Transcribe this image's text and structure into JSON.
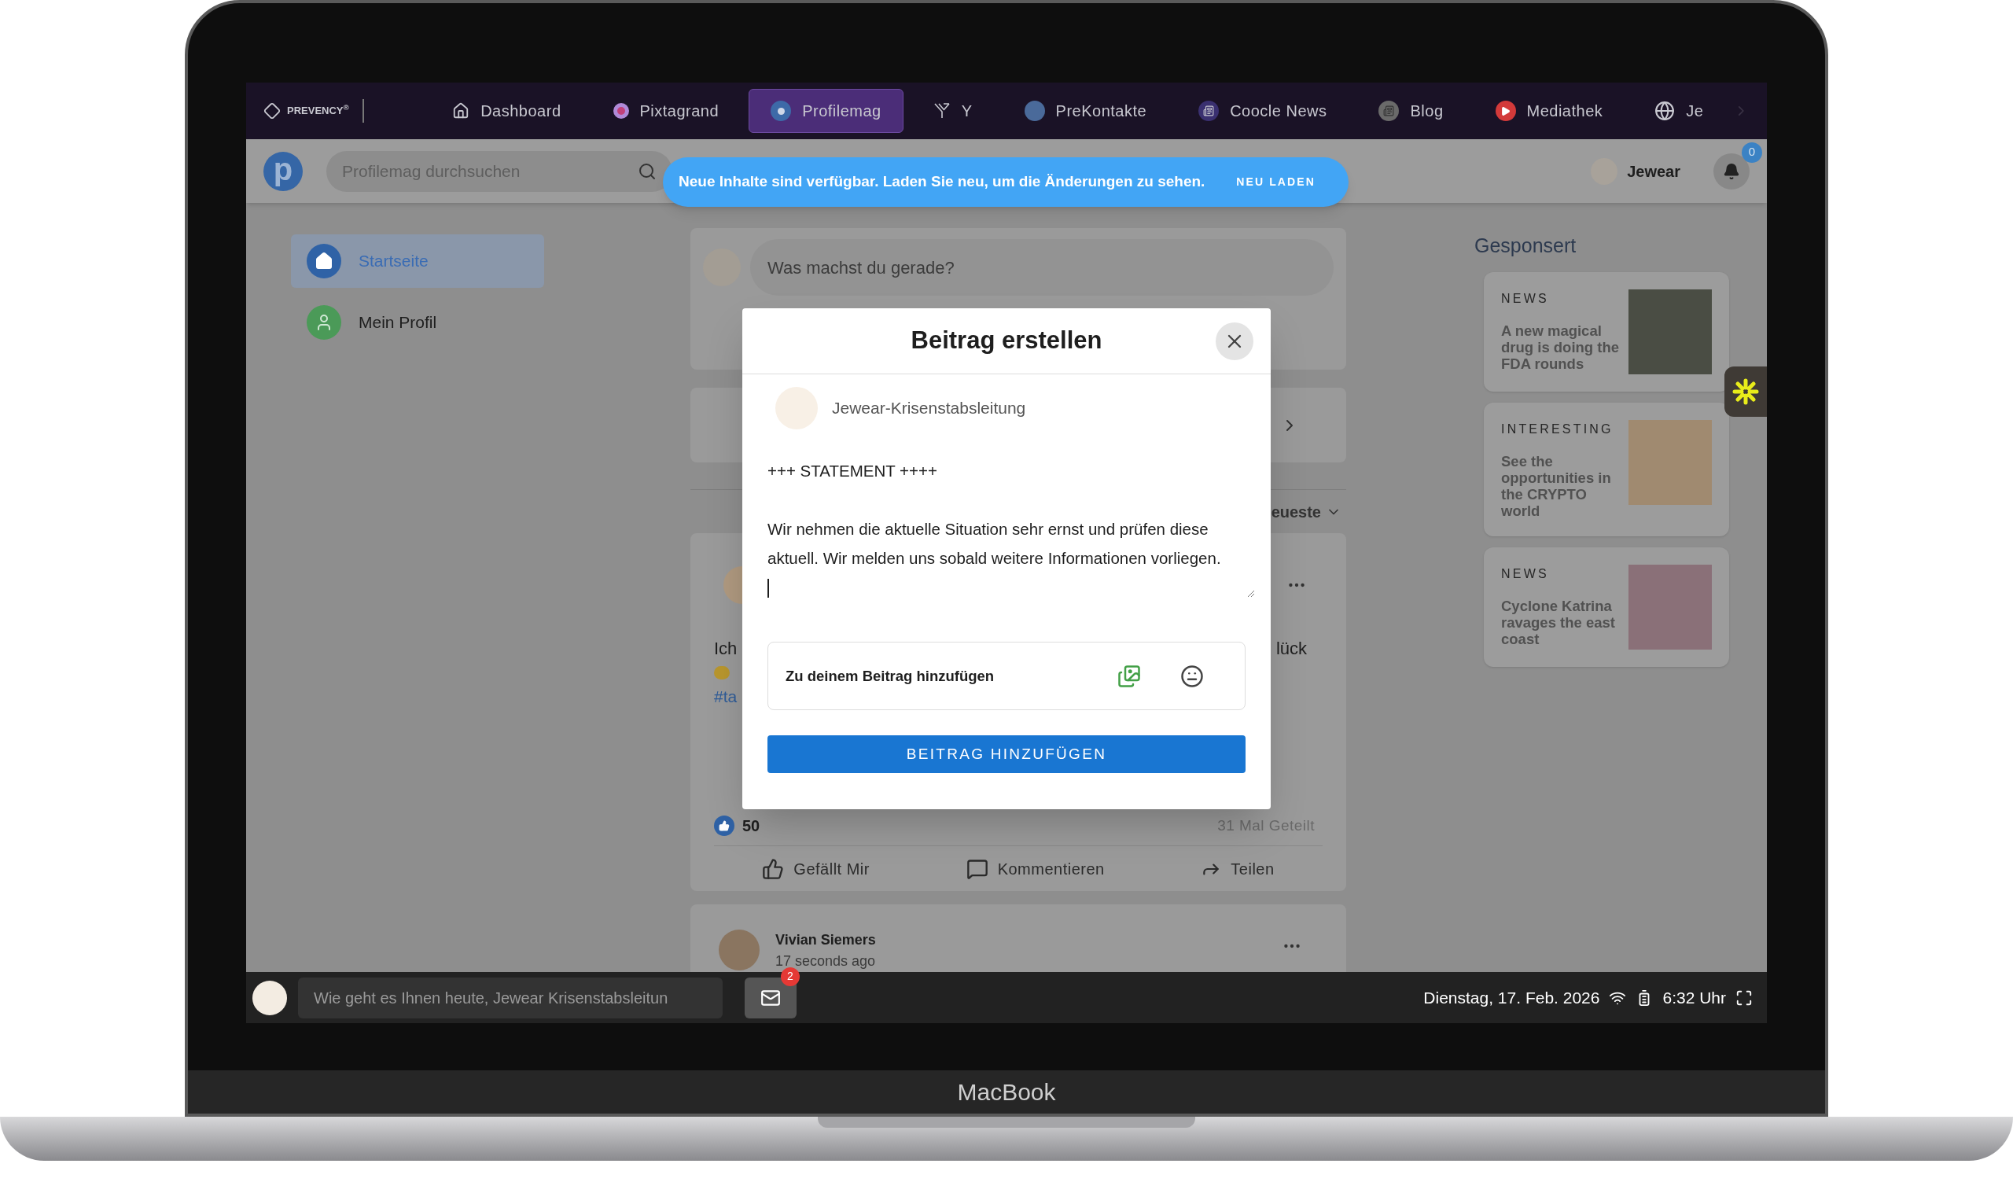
{
  "top_nav": {
    "logo": "PREVENCY$^{®}$",
    "items": [
      {
        "label": "Dashboard",
        "selected": false
      },
      {
        "label": "Pixtagrand",
        "selected": false
      },
      {
        "label": "Profilemag",
        "selected": true
      },
      {
        "label": "Y",
        "selected": false
      },
      {
        "label": "PreKontakte",
        "selected": false
      },
      {
        "label": "Coocle News",
        "selected": false
      },
      {
        "label": "Blog",
        "selected": false
      },
      {
        "label": "Mediathek",
        "selected": false
      },
      {
        "label": "Je",
        "selected": false
      }
    ]
  },
  "header": {
    "logo": "p",
    "search_placeholder": "Profilemag durchsuchen",
    "user": "Jewear",
    "notification_count": "0"
  },
  "toast": {
    "message": "Neue Inhalte sind verfügbar. Laden Sie neu, um die Änderungen zu sehen.",
    "action": "NEU LADEN"
  },
  "sidebar": {
    "items": [
      {
        "label": "Startseite",
        "selected": true
      },
      {
        "label": "Mein Profil",
        "selected": false
      }
    ]
  },
  "feed": {
    "composer_placeholder": "Was machst du gerade?",
    "sort_label": "eueste",
    "post": {
      "text_start": "Ich",
      "text_end": "lück",
      "hashtag": "#ta",
      "likes": "50",
      "shares": "31 Mal Geteilt",
      "actions": [
        "Gefällt Mir",
        "Kommentieren",
        "Teilen"
      ]
    },
    "next_post": {
      "author": "Vivian Siemers",
      "time": "17 seconds ago"
    }
  },
  "sponsored": {
    "title": "Gesponsert",
    "ads": [
      {
        "category": "NEWS",
        "headline": "A new magical drug is doing the FDA rounds"
      },
      {
        "category": "INTERESTING",
        "headline": "See the opportunities in the CRYPTO world"
      },
      {
        "category": "NEWS",
        "headline": "Cyclone Katrina ravages the east coast"
      }
    ]
  },
  "modal": {
    "title": "Beitrag erstellen",
    "author": "Jewear-Krisenstabsleitung",
    "paragraphs": [
      "+++ STATEMENT ++++",
      "Wir nehmen die aktuelle Situation sehr ernst und prüfen diese aktuell. Wir melden uns sobald weitere Informationen vorliegen."
    ],
    "add_label": "Zu deinem Beitrag hinzufügen",
    "submit": "BEITRAG HINZUFÜGEN"
  },
  "taskbar": {
    "placeholder": "Wie geht es Ihnen heute, Jewear Krisenstabsleitun",
    "mail_count": "2",
    "date": "Dienstag, 17. Feb. 2026",
    "time": "6:32 Uhr"
  },
  "laptop": {
    "brand": "MacBook"
  }
}
